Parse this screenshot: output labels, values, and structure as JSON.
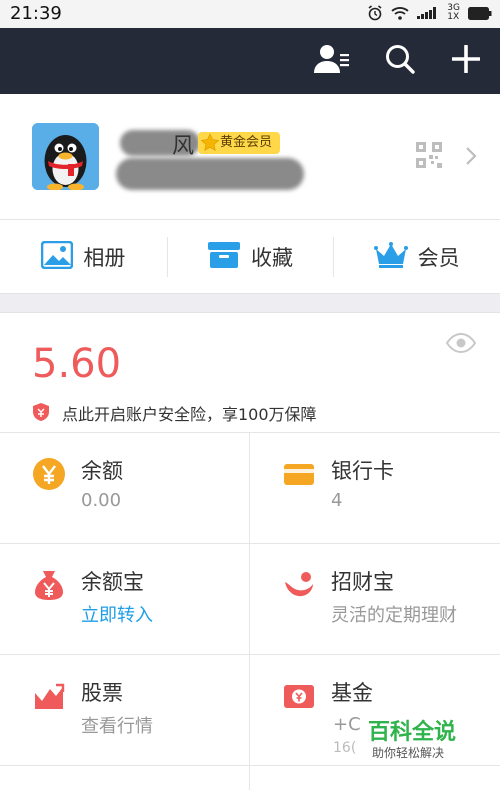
{
  "status": {
    "time": "21:39",
    "net_top": "3G",
    "net_bottom": "1X"
  },
  "profile": {
    "name_visible_char": "风",
    "vip_badge": "黄金会员"
  },
  "quick_actions": [
    {
      "label": "相册",
      "icon": "album-icon"
    },
    {
      "label": "收藏",
      "icon": "favorites-icon"
    },
    {
      "label": "会员",
      "icon": "crown-icon"
    }
  ],
  "wallet": {
    "balance": "5.60",
    "insurance_text": "点此开启账户安全险，享100万保障"
  },
  "items": [
    {
      "title": "余额",
      "sub": "0.00",
      "icon": "yuan-coin-icon",
      "color": "#f5a623"
    },
    {
      "title": "银行卡",
      "sub": "4",
      "icon": "bank-card-icon",
      "color": "#f5a623"
    },
    {
      "title": "余额宝",
      "sub": "立即转入",
      "icon": "money-bag-icon",
      "color": "#ef5b5b"
    },
    {
      "title": "招财宝",
      "sub": "灵活的定期理财",
      "icon": "zhaocaibao-icon",
      "color": "#ef5b5b"
    },
    {
      "title": "股票",
      "sub": "查看行情",
      "icon": "stock-chart-icon",
      "color": "#ef5b5b"
    },
    {
      "title": "基金",
      "sub": "+C",
      "sub2": "16(",
      "icon": "fund-icon",
      "color": "#ef5b5b"
    }
  ],
  "watermark": {
    "title": "百科全说",
    "subtitle": "助你轻松解决"
  },
  "colors": {
    "top_bar": "#242a38",
    "balance_red": "#ef5b5b",
    "link_blue": "#1e9ee8",
    "vip_gold": "#ffd84a"
  }
}
